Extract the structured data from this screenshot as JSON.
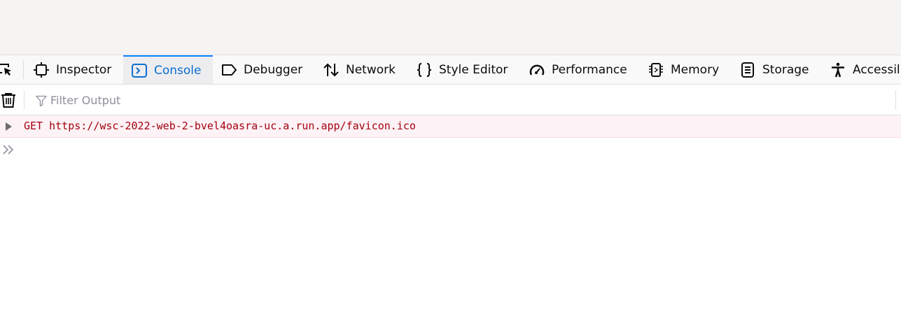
{
  "toolbar": {
    "picker_icon": "element-picker-icon",
    "tabs": [
      {
        "label": "Inspector",
        "icon": "inspector-icon"
      },
      {
        "label": "Console",
        "icon": "console-icon",
        "active": true
      },
      {
        "label": "Debugger",
        "icon": "debugger-icon"
      },
      {
        "label": "Network",
        "icon": "network-icon"
      },
      {
        "label": "Style Editor",
        "icon": "style-editor-icon"
      },
      {
        "label": "Performance",
        "icon": "performance-icon"
      },
      {
        "label": "Memory",
        "icon": "memory-icon"
      },
      {
        "label": "Storage",
        "icon": "storage-icon"
      },
      {
        "label": "Accessil",
        "icon": "accessibility-icon"
      }
    ]
  },
  "filter": {
    "placeholder": "Filter Output",
    "value": ""
  },
  "console": {
    "messages": [
      {
        "method": "GET",
        "url": "https://wsc-2022-web-2-bvel4oasra-uc.a.run.app/favicon.ico",
        "level": "error"
      }
    ]
  },
  "colors": {
    "accent": "#0a84ff",
    "active_text": "#0a6ed1",
    "error_text": "#a4000f",
    "error_bg": "#fdf2f5"
  }
}
